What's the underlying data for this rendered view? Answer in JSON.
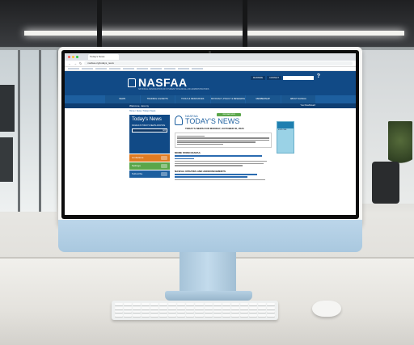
{
  "browser": {
    "tab_title": "Today's News",
    "address": "nasfaa.org/todays_news"
  },
  "site": {
    "logo": "NASFAA",
    "tagline": "NATIONAL ASSOCIATION OF STUDENT FINANCIAL AID ADMINISTRATORS",
    "login_label": "MAXIMIZE",
    "contact_label": "CONTACT",
    "nav": [
      "NEWS",
      "TRAINING & EVENTS",
      "TOOLS & RESOURCES",
      "ADVOCACY, POLICY & RESEARCH",
      "MEMBERSHIP",
      "ABOUT NASFAA"
    ],
    "welcome": "Welcome, Jeremy",
    "welcome_right": "Your Dashboard"
  },
  "left_panel": {
    "title": "Today's News",
    "subtitle": "NASFAA'S TODAY'S NEWS ARCHIVE",
    "go_label": "GO",
    "buttons": [
      {
        "label": "Limitations",
        "color": "#e07b22"
      },
      {
        "label": "Settings",
        "color": "#5aa64a"
      },
      {
        "label": "Subscribe",
        "color": "#1d5f9f"
      }
    ]
  },
  "main": {
    "crumbs": "Home / News / Today's News",
    "wordmark_small": "NASFAA",
    "wordmark_big": "TODAY'S NEWS",
    "date": "TODAY'S NEWS FOR MONDAY, OCTOBER 30, 2023",
    "pill": "VIEW ARCHIVE",
    "section1": "MORE FROM NASFAA",
    "section2": "NASFAA UPDATES AND ANNOUNCEMENTS"
  },
  "ad": {
    "text": "EXPLORE"
  }
}
